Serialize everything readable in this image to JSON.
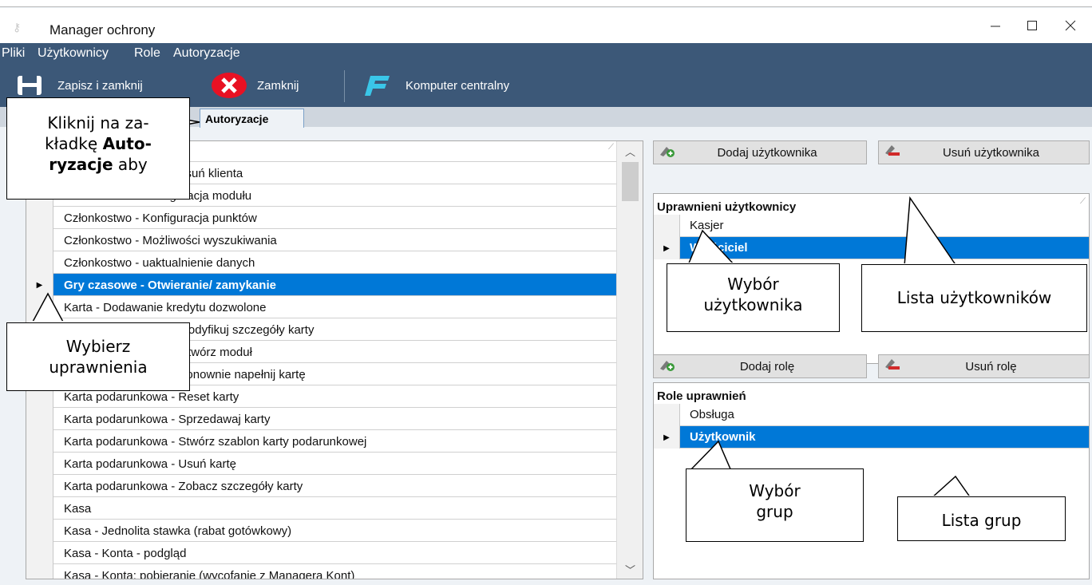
{
  "window": {
    "title": "Manager ochrony"
  },
  "menu": [
    "Pliki",
    "Użytkownicy",
    "Role",
    "Autoryzacje"
  ],
  "toolbar": {
    "save_close": "Zapisz i zamknij",
    "close": "Zamknij",
    "central": "Komputer centralny"
  },
  "tab": {
    "active": "Autoryzacje"
  },
  "permissions": {
    "rows": [
      "Członkostwo - Dodaj/Usuń klienta",
      "Członkostwo - Konfiguracja modułu",
      "Członkostwo - Konfiguracja punktów",
      "Członkostwo - Możliwości wyszukiwania",
      "Członkostwo - uaktualnienie danych",
      "Gry czasowe - Otwieranie/ zamykanie",
      "Karta - Dodawanie kredytu dozwolone",
      "Karta podarunkowa - Modyfikuj szczegóły karty",
      "Karta podarunkowa - Otwórz moduł",
      "Karta podarunkowa - Ponownie napełnij kartę",
      "Karta podarunkowa - Reset karty",
      "Karta podarunkowa - Sprzedawaj karty",
      "Karta podarunkowa - Stwórz szablon karty podarunkowej",
      "Karta podarunkowa - Usuń kartę",
      "Karta podarunkowa - Zobacz szczegóły karty",
      "Kasa",
      "Kasa - Jednolita stawka (rabat gotówkowy)",
      "Kasa - Konta - podgląd",
      "Kasa - Konta: pobieranie (wycofanie z Managera Kont)"
    ],
    "selected_index": 5
  },
  "users": {
    "add_label": "Dodaj użytkownika",
    "remove_label": "Usuń użytkownika",
    "header": "Uprawnieni użytkownicy",
    "items": [
      "Kasjer",
      "Właściciel"
    ],
    "selected_index": 1
  },
  "roles": {
    "add_label": "Dodaj rolę",
    "remove_label": "Usuń rolę",
    "header": "Role uprawnień",
    "items": [
      "Obsługa",
      "Użytkownik"
    ],
    "selected_index": 1
  },
  "callouts": {
    "tab_line1": "Kliknij na za-",
    "tab_line2a": "kładkę ",
    "tab_line2b": "Auto-",
    "tab_line3a": "ryzacje",
    "tab_line3b": " aby",
    "choose_permissions": "Wybierz uprawnienia",
    "user_choice": "Wybór użytkownika",
    "user_list": "Lista użytkowników",
    "group_choice": "Wybór grup",
    "group_list": "Lista grup"
  },
  "colors": {
    "toolbar_bg": "#3c5878",
    "selection": "#0078d7",
    "close_red": "#e81123",
    "central_cyan": "#3ac6e8"
  }
}
